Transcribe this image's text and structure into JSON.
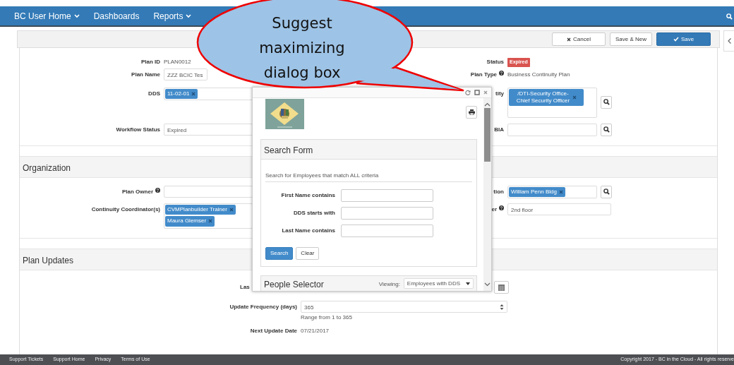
{
  "navbar": {
    "items": [
      {
        "label": "BC User Home",
        "dropdown": true
      },
      {
        "label": "Dashboards",
        "dropdown": false
      },
      {
        "label": "Reports",
        "dropdown": true
      }
    ]
  },
  "toolbar": {
    "buttons": [
      {
        "label": "Cancel",
        "kind": "cancel"
      },
      {
        "label": "Save & New",
        "kind": "plain"
      },
      {
        "label": "Save",
        "kind": "primary"
      }
    ]
  },
  "plan": {
    "rows": [
      {
        "left": {
          "label": "Plan ID",
          "kind": "text",
          "value": "PLAN0012"
        },
        "right": {
          "label": "Status",
          "kind": "badge",
          "value": "Expired"
        }
      },
      {
        "left": {
          "label": "Plan Name",
          "kind": "input",
          "value": "ZZZ BCIC Tes"
        },
        "right": {
          "label": "Plan Type",
          "help": true,
          "kind": "text",
          "value": "Business Continuity Plan"
        }
      },
      {
        "left": {
          "label": "DDS",
          "kind": "tags",
          "tags": [
            "11-02-01"
          ]
        },
        "right": {
          "label": "tity",
          "kind": "lookup",
          "tags": [
            "/DTI-Security Office-Chief Security Officer"
          ]
        }
      },
      {
        "left": {
          "label": "Workflow Status",
          "kind": "input",
          "value": "Expired"
        },
        "right": {
          "label": "BIA",
          "kind": "lookup"
        }
      }
    ]
  },
  "organization": {
    "title": "Organization",
    "rows": [
      {
        "left": {
          "label": "Plan Owner",
          "help": true,
          "kind": "input"
        },
        "right": {
          "label": "tion",
          "kind": "lookup",
          "tags": [
            "William Penn Bldg"
          ]
        }
      },
      {
        "left": {
          "label": "Continuity Coordinator(s)",
          "kind": "tags",
          "tags": [
            "CVMPlanbuilder Trainer",
            "Maura Glemser"
          ]
        },
        "right": {
          "label": "er",
          "help": true,
          "kind": "input",
          "value": "2nd floor"
        }
      }
    ]
  },
  "plan_updates": {
    "title": "Plan Updates",
    "last_label": "Las",
    "frequency_label": "Update Frequency (days)",
    "frequency_value": "365",
    "frequency_help": "Range from 1 to 365",
    "next_label": "Next Update Date",
    "next_value": "07/21/2017"
  },
  "dialog": {
    "search_form": {
      "title": "Search Form",
      "intro": "Search for Employees that match ALL criteria",
      "fields": [
        {
          "label": "First Name contains"
        },
        {
          "label": "DDS starts with"
        },
        {
          "label": "Last Name contains"
        }
      ],
      "buttons": [
        {
          "label": "Search",
          "kind": "primary"
        },
        {
          "label": "Clear",
          "kind": "plain"
        }
      ]
    },
    "people_selector": {
      "title": "People Selector",
      "viewing_label": "Viewing:",
      "viewing_value": "Employees with DDS"
    }
  },
  "callout": {
    "text": "Suggest maximizing dialog box"
  },
  "footer": {
    "links": [
      "Support Tickets",
      "Support Home",
      "Privacy",
      "Terms of Use"
    ],
    "copyright": "Copyright 2017 - BC in the Cloud - All rights reserve"
  }
}
